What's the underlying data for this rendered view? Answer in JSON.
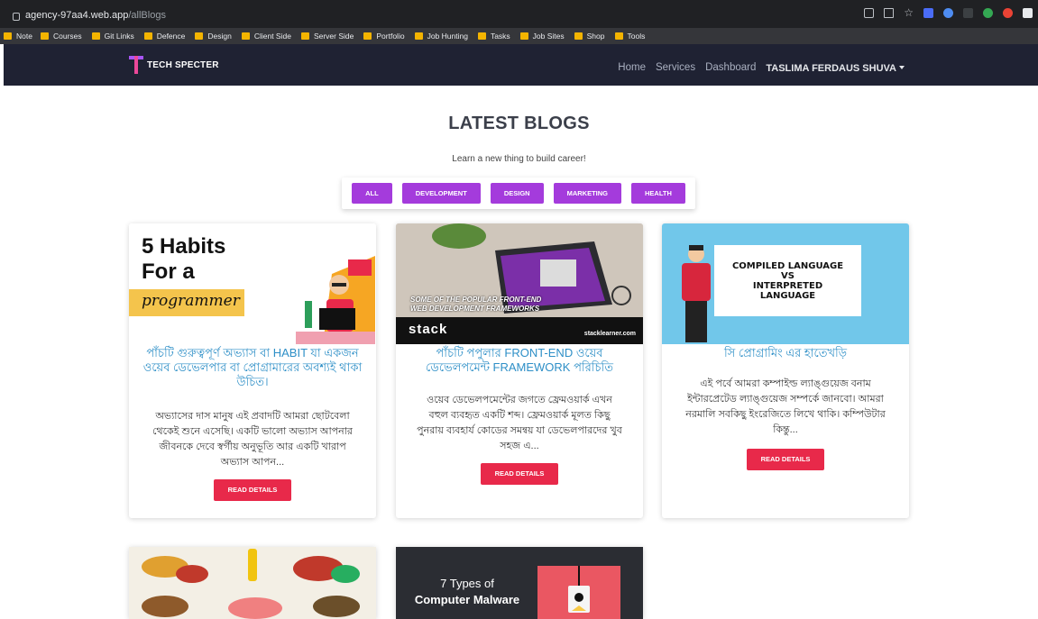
{
  "browser": {
    "url_host": "agency-97aa4.web.app",
    "url_path": "/allBlogs",
    "bookmarks": [
      "Note",
      "Courses",
      "Git Links",
      "Defence",
      "Design",
      "Client Side",
      "Server Side",
      "Portfolio",
      "Job Hunting",
      "Tasks",
      "Job Sites",
      "Shop",
      "Tools"
    ]
  },
  "navbar": {
    "brand": "TECH SPECTER",
    "links": [
      "Home",
      "Services",
      "Dashboard"
    ],
    "user": "TASLIMA FERDAUS SHUVA"
  },
  "main": {
    "title": "LATEST BLOGS",
    "subtitle": "Learn a new thing to build career!",
    "filters": [
      "ALL",
      "DEVELOPMENT",
      "DESIGN",
      "MARKETING",
      "HEALTH"
    ]
  },
  "cards": [
    {
      "image_text": {
        "line1": "5 Habits",
        "line2": "For a",
        "line3": "programmer"
      },
      "title": "পাঁচটি গুরুত্বপূর্ণ অভ্যাস বা HABIT যা একজন ওয়েব ডেভেলপার বা প্রোগ্রামারের অবশ্যই থাকা উচিত।",
      "description": "অভ্যাসের দাস মানুষ এই প্রবাদটি আমরা ছোটবেলা থেকেই শুনে এসেছি। একটি ভালো অভ্যাস আপনার জীবনকে দেবে স্বর্গীয় অনুভূতি আর একটি খারাপ অভ্যাস আপন...",
      "button": "READ DETAILS"
    },
    {
      "image_text": {
        "caption": "SOME OF THE POPULAR FRONT-END WEB DEVELOPMENT FRAMEWORKS",
        "brand": "stack",
        "url": "stacklearner.com"
      },
      "title": "পাঁচটি পপুলার FRONT-END ওয়েব ডেভেলপমেন্ট FRAMEWORK পরিচিতি",
      "description": "ওয়েব ডেভেলপমেন্টের জগতে ফ্রেমওয়ার্ক এখন বহুল ব্যবহৃত একটি শব্দ। ফ্রেমওয়ার্ক মূলত কিছু পুনরায় ব্যবহার্য কোডের সমন্বয় যা ডেভেলপারদের খুব সহজ এ...",
      "button": "READ DETAILS"
    },
    {
      "image_text": {
        "line1": "COMPILED LANGUAGE",
        "line2": "VS",
        "line3": "INTERPRETED",
        "line4": "LANGUAGE"
      },
      "title": "সি প্রোগ্রামিং এর হাতেখড়ি",
      "description": "এই পর্বে আমরা কম্পাইল্ড ল্যাঙ্গুয়েজ বনাম ইন্টারপ্রেটেড ল্যাঙ্গুয়েজ সম্পর্কে জানবো। আমরা নরমালি সবকিছু ইংরেজিতে লিখে থাকি। কম্পিউটার কিন্তু...",
      "button": "READ DETAILS"
    }
  ],
  "bottom_cards": [
    {
      "image_text": ""
    },
    {
      "image_text": {
        "line1": "7 Types of",
        "line2": "Computer Malware"
      }
    }
  ]
}
